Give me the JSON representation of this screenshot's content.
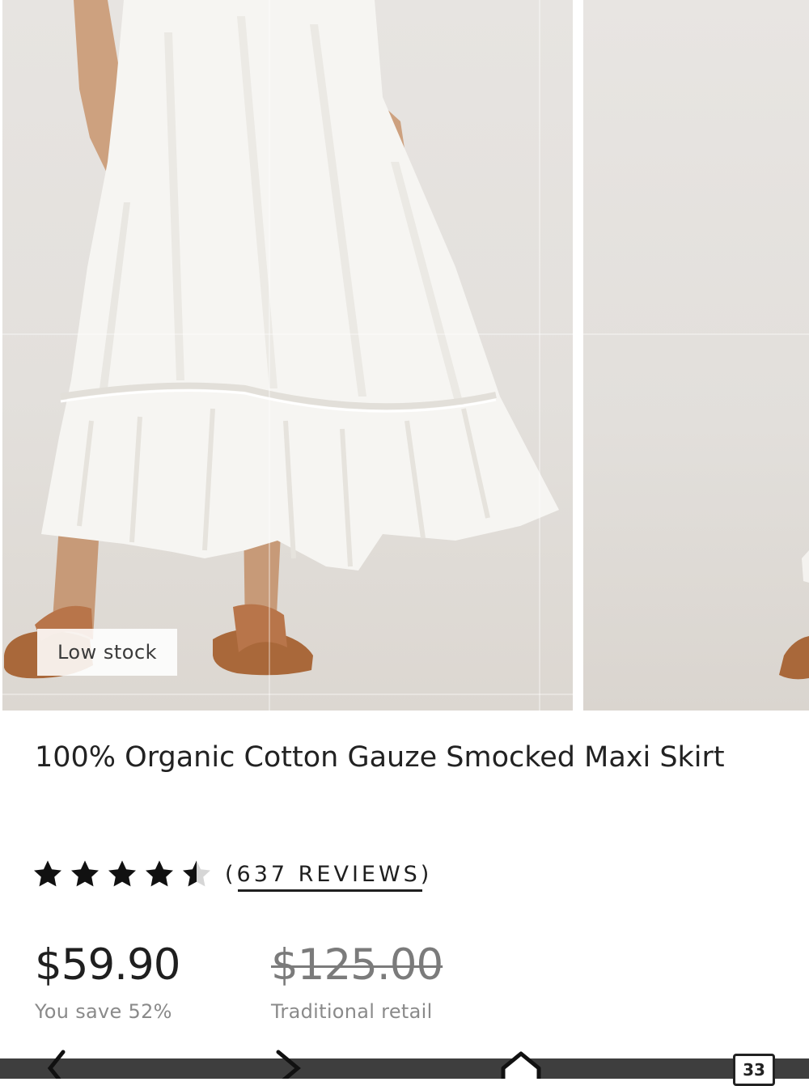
{
  "gallery": {
    "stock_badge": "Low stock"
  },
  "product": {
    "title": "100% Organic Cotton Gauze Smocked Maxi Skirt",
    "rating": 4.5,
    "reviews_text": "(637 REVIEWS)",
    "price": "$59.90",
    "savings": "You save 52%",
    "original_price": "$125.00",
    "original_label": "Traditional retail"
  },
  "browser": {
    "tab_count": "33"
  },
  "colors": {
    "text": "#1f1f1f",
    "muted": "#8a8a8a",
    "sandal": "#a9683a",
    "skirt": "#f7f6f3"
  },
  "icons": [
    "star-icon",
    "star-half-icon",
    "back-arrow-icon",
    "forward-arrow-icon",
    "home-icon",
    "tabs-icon"
  ]
}
